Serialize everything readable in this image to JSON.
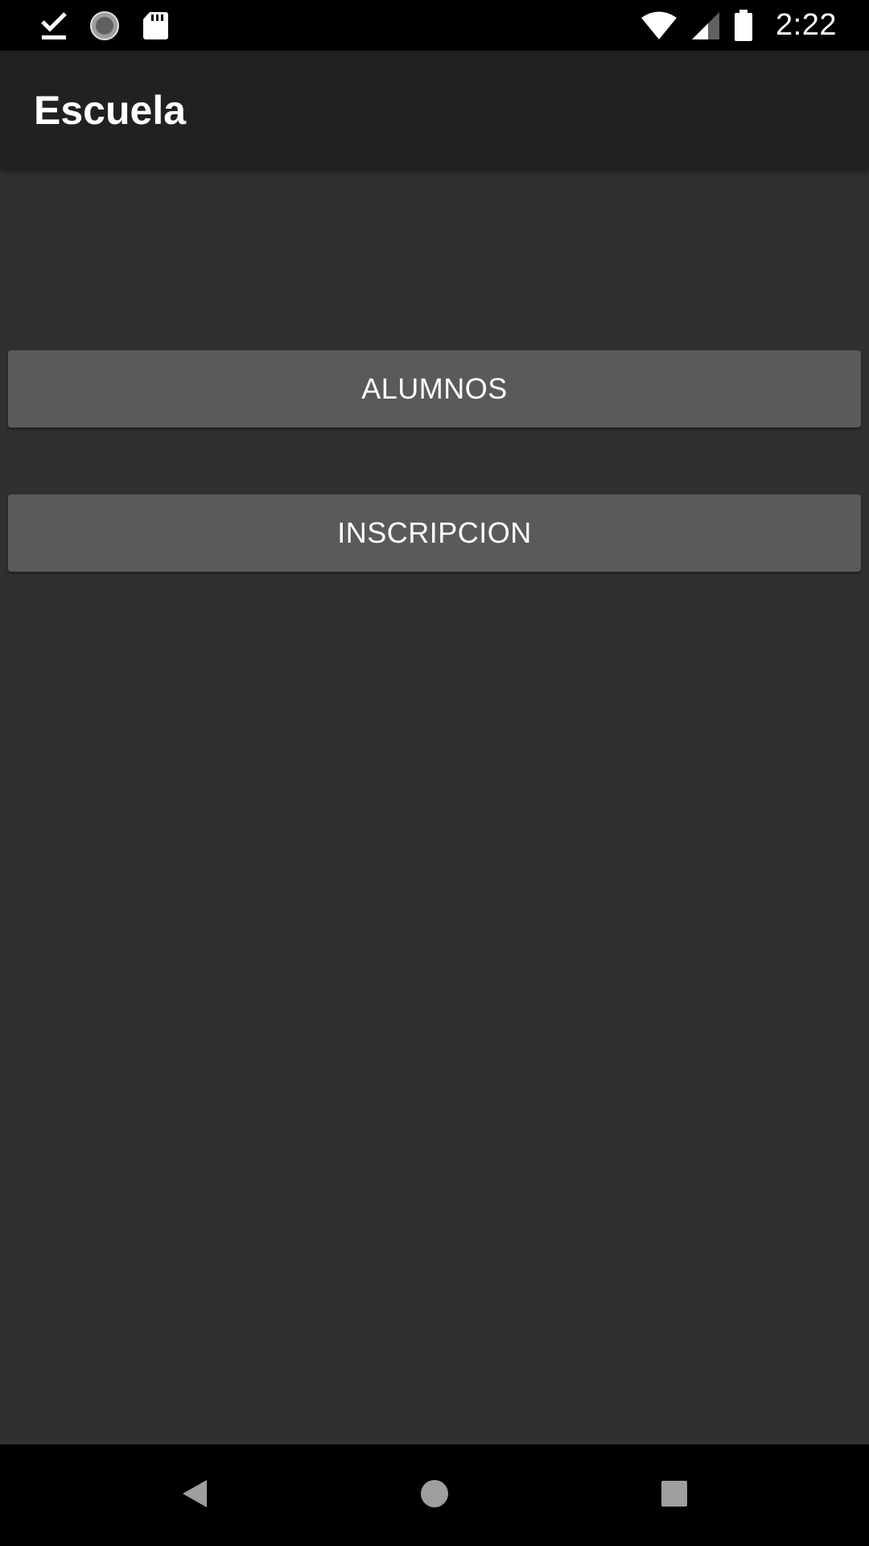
{
  "status_bar": {
    "time": "2:22",
    "left_icons": [
      "download-done-icon",
      "sync-circle-icon",
      "sd-card-icon"
    ],
    "right_icons": [
      "wifi-icon",
      "cell-signal-icon",
      "battery-icon"
    ]
  },
  "app_bar": {
    "title": "Escuela"
  },
  "buttons": {
    "alumnos_label": "ALUMNOS",
    "inscripcion_label": "INSCRIPCION"
  },
  "nav_bar": {
    "icons": [
      "back-icon",
      "home-icon",
      "recents-icon"
    ]
  },
  "colors": {
    "background": "#303030",
    "app_bar": "#212121",
    "button": "#5a5a5b",
    "system_bars": "#000000",
    "text": "#ffffff"
  }
}
